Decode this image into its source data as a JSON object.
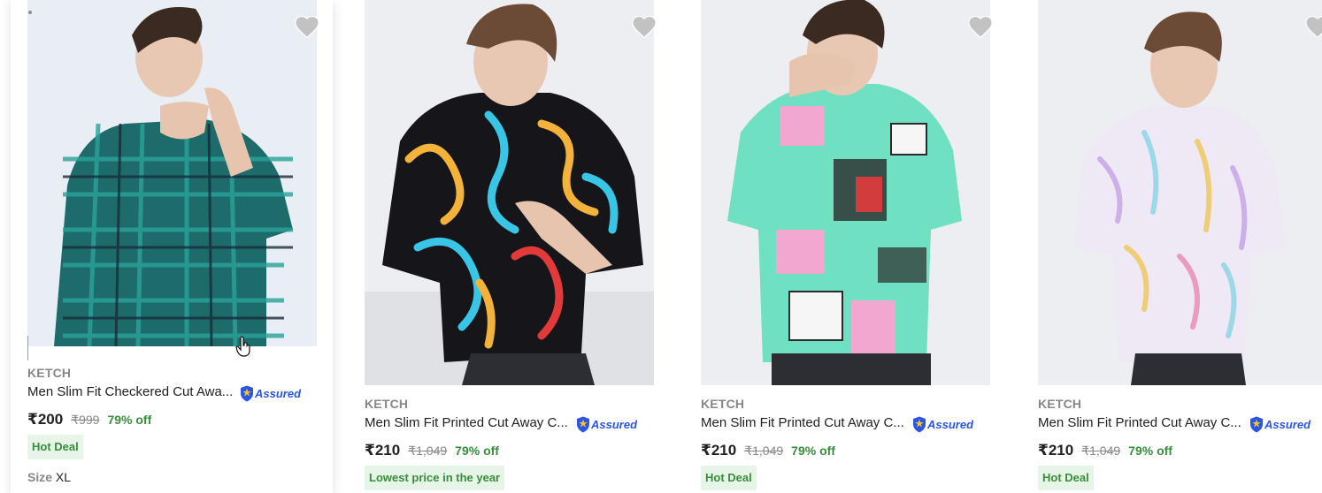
{
  "products": [
    {
      "brand": "KETCH",
      "title": "Men Slim Fit Checkered Cut Awa...",
      "assured": "Assured",
      "price": "₹200",
      "mrp": "₹999",
      "discount": "79% off",
      "badge": "Hot Deal",
      "size_label": "Size",
      "size_value": "XL",
      "image": "green-checkered-shirt-photo",
      "shirt_colors": [
        "#1d6b6a",
        "#2aa39a",
        "#1a2b3c"
      ]
    },
    {
      "brand": "KETCH",
      "title": "Men Slim Fit Printed Cut Away C...",
      "assured": "Assured",
      "price": "₹210",
      "mrp": "₹1,049",
      "discount": "79% off",
      "badge": "Lowest price in the year",
      "image": "neon-squiggle-printed-shirt-photo",
      "shirt_colors": [
        "#15151a",
        "#f3b23a",
        "#39c6e6",
        "#e23a3a"
      ]
    },
    {
      "brand": "KETCH",
      "title": "Men Slim Fit Printed Cut Away C...",
      "assured": "Assured",
      "price": "₹210",
      "mrp": "₹1,049",
      "discount": "79% off",
      "badge": "Hot Deal",
      "image": "graffiti-printed-shirt-photo",
      "shirt_colors": [
        "#6fe0c2",
        "#f2a7d0",
        "#2a2a2a",
        "#d33c3c"
      ]
    },
    {
      "brand": "KETCH",
      "title": "Men Slim Fit Printed Cut Away C...",
      "assured": "Assured",
      "price": "₹210",
      "mrp": "₹1,049",
      "discount": "79% off",
      "badge": "Hot Deal",
      "image": "pastel-paint-printed-shirt-photo",
      "shirt_colors": [
        "#efe9f5",
        "#c7a6e8",
        "#8fd6e8",
        "#f0c860"
      ]
    }
  ],
  "colors": {
    "price_green": "#388e3c",
    "badge_bg": "#e6f5e7",
    "assured_blue": "#2a55e5",
    "wishlist_gray": "#c2c2c2",
    "muted_text": "#878787"
  }
}
